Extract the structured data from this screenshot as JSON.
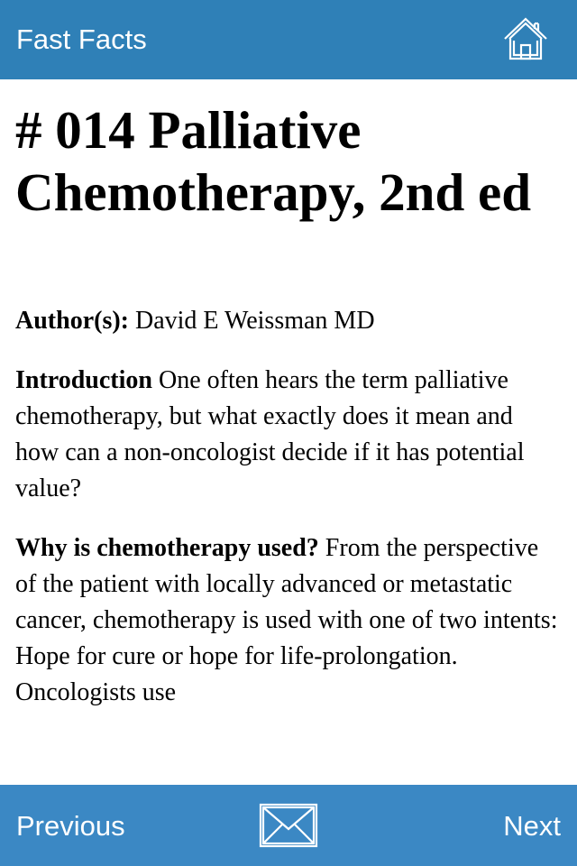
{
  "header": {
    "title": "Fast Facts",
    "home_icon": "home-icon"
  },
  "article": {
    "title": "# 014 Palliative Chemotherapy, 2nd ed",
    "author_label": "Author(s):",
    "author_value": " David E Weissman MD",
    "intro_heading": "Introduction",
    "intro_text": " One often hears the term palliative chemotherapy, but what exactly does it mean and how can a non-oncologist decide if it has potential value?",
    "why_heading": "Why is chemotherapy used?",
    "why_text": " From the perspective of the patient with locally advanced or metastatic cancer, chemotherapy is used with one of two intents: Hope for cure or hope for life-prolongation. Oncologists use"
  },
  "footer": {
    "previous_label": "Previous",
    "next_label": "Next",
    "mail_icon": "envelope-icon"
  },
  "colors": {
    "header_bg": "#2f80b7",
    "footer_bg": "#3b88c4",
    "bar_text": "#ffffff"
  }
}
